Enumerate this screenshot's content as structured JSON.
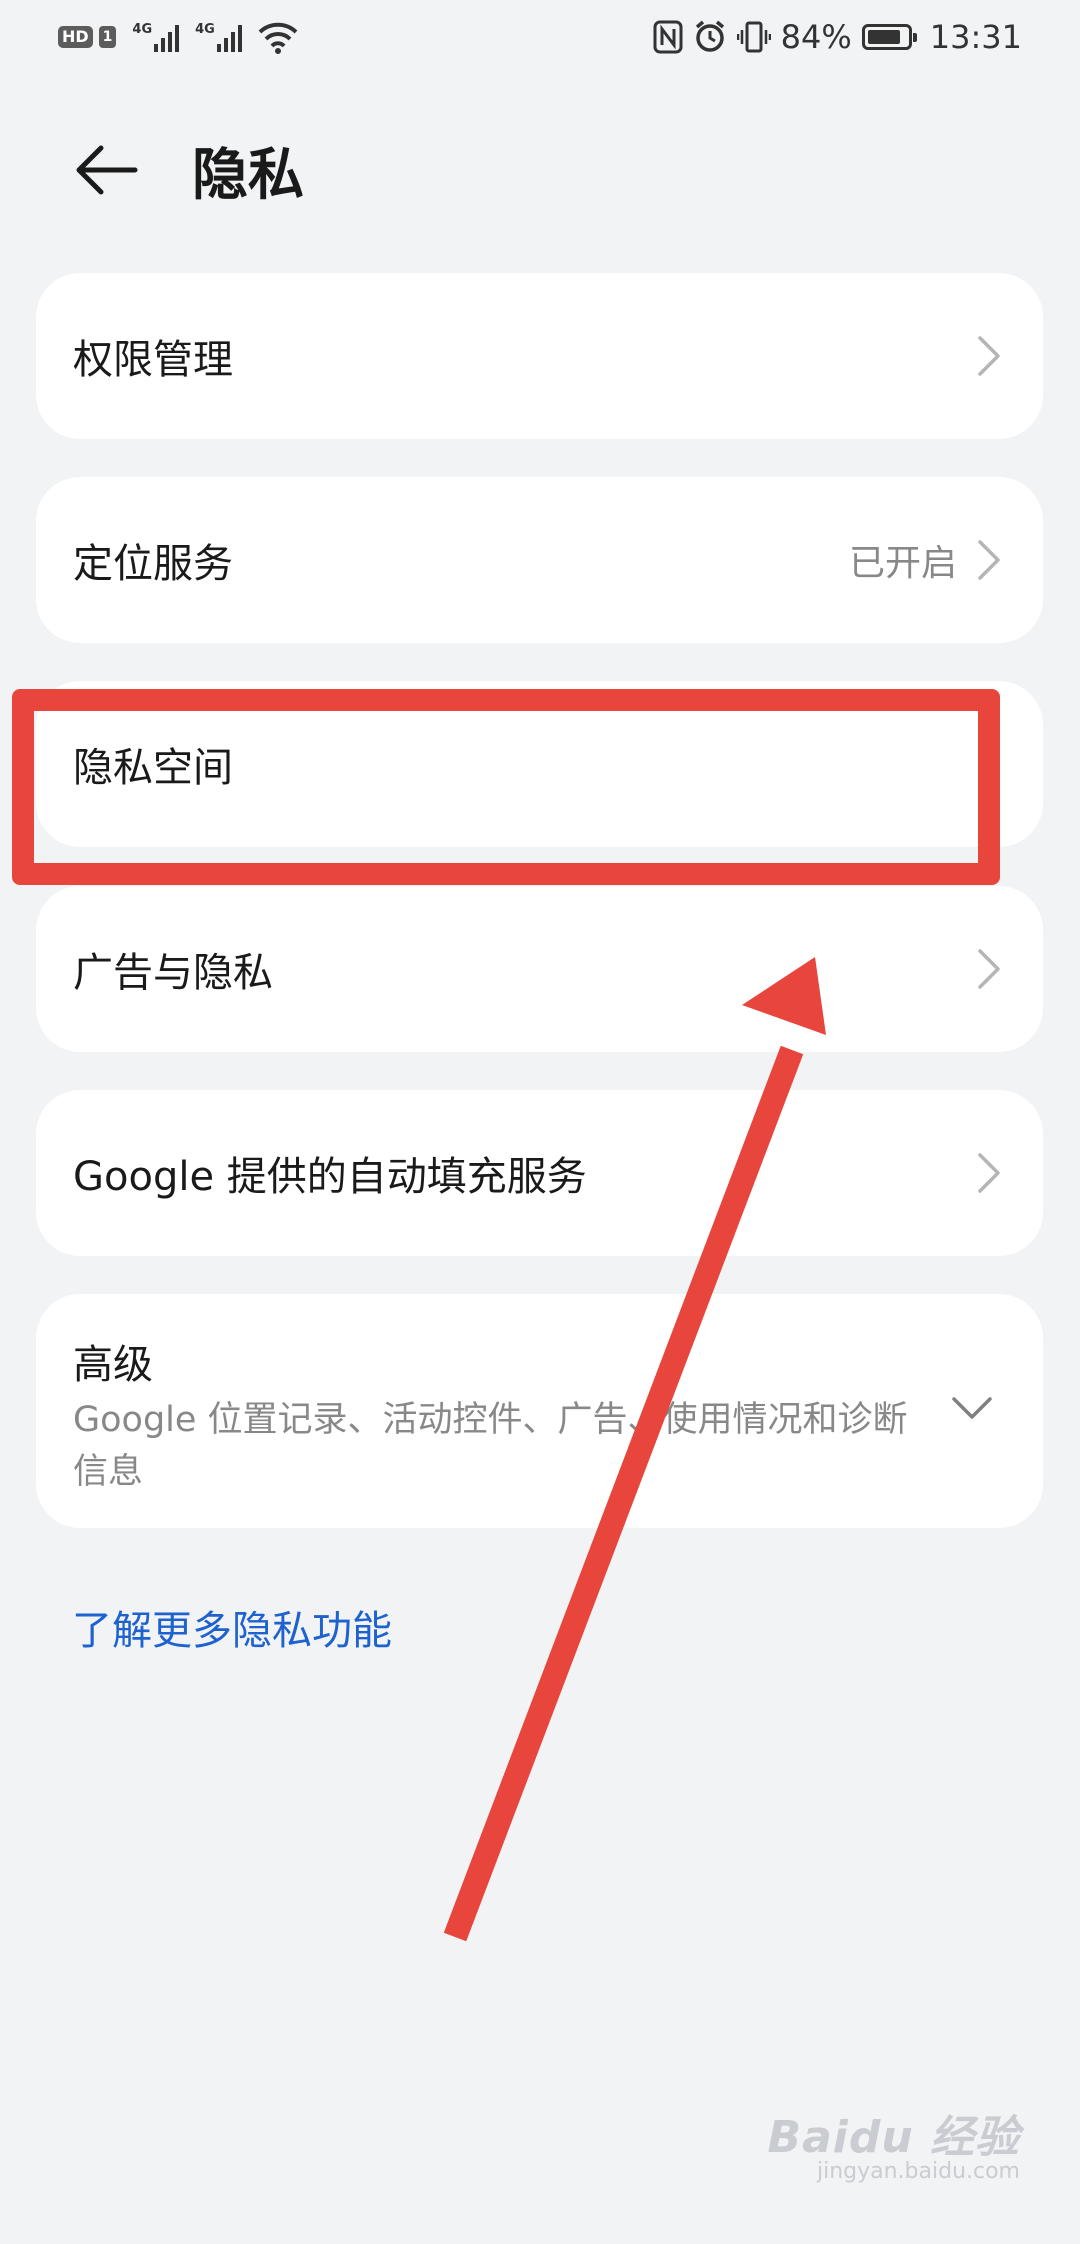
{
  "status_bar": {
    "hd": "HD",
    "sim": "1",
    "net1": "4G",
    "net2": "4G",
    "battery_pct": "84%",
    "battery_level": 0.84,
    "time": "13:31"
  },
  "header": {
    "title": "隐私"
  },
  "items": [
    {
      "label": "权限管理"
    },
    {
      "label": "定位服务",
      "value": "已开启"
    },
    {
      "label": "隐私空间"
    },
    {
      "label": "广告与隐私"
    },
    {
      "label": "Google 提供的自动填充服务"
    }
  ],
  "advanced": {
    "label": "高级",
    "description": "Google 位置记录、活动控件、广告、使用情况和诊断信息"
  },
  "more_link": "了解更多隐私功能",
  "watermark": {
    "main": "Baidu 经验",
    "sub": "jingyan.baidu.com"
  },
  "colors": {
    "accent_link": "#1e62d0",
    "annotation": "#e8453c",
    "background": "#f1f3f5"
  }
}
